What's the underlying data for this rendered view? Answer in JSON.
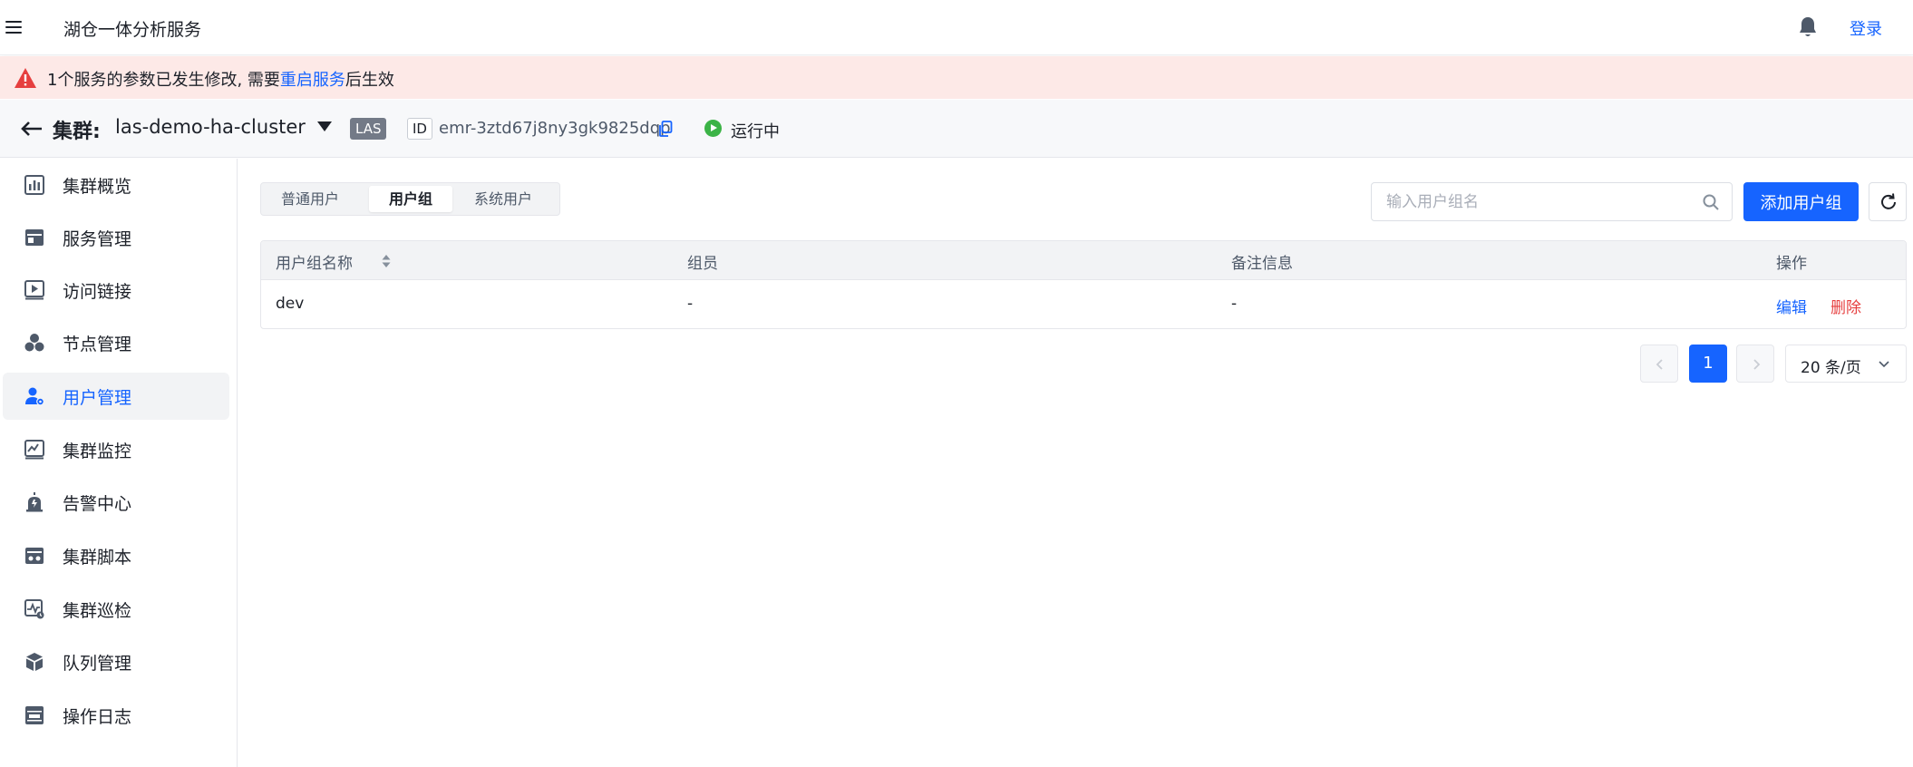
{
  "header": {
    "app_title": "湖仓一体分析服务",
    "login_label": "登录"
  },
  "alert": {
    "text_before": "1个服务的参数已发生修改, 需要",
    "link": "重启服务",
    "text_after": "后生效"
  },
  "cluster": {
    "label": "集群:",
    "name": "las-demo-ha-cluster",
    "badge": "LAS",
    "id_label": "ID",
    "id_value": "emr-3ztd67j8ny3gk9825dqp",
    "status": "运行中",
    "status_color": "#3bb346"
  },
  "sidebar": {
    "active_index": 4,
    "items": [
      {
        "label": "集群概览",
        "icon": "bar-chart-icon"
      },
      {
        "label": "服务管理",
        "icon": "service-icon"
      },
      {
        "label": "访问链接",
        "icon": "link-play-icon"
      },
      {
        "label": "节点管理",
        "icon": "nodes-icon"
      },
      {
        "label": "用户管理",
        "icon": "user-settings-icon"
      },
      {
        "label": "集群监控",
        "icon": "monitor-icon"
      },
      {
        "label": "告警中心",
        "icon": "alarm-icon"
      },
      {
        "label": "集群脚本",
        "icon": "script-icon"
      },
      {
        "label": "集群巡检",
        "icon": "inspect-icon"
      },
      {
        "label": "队列管理",
        "icon": "queue-cube-icon"
      },
      {
        "label": "操作日志",
        "icon": "log-icon"
      }
    ]
  },
  "tabs": [
    {
      "label": "普通用户"
    },
    {
      "label": "用户组",
      "active": true
    },
    {
      "label": "系统用户"
    }
  ],
  "search": {
    "placeholder": "输入用户组名"
  },
  "toolbar": {
    "add_label": "添加用户组"
  },
  "table": {
    "columns": [
      "用户组名称",
      "组员",
      "备注信息",
      "操作"
    ],
    "rows": [
      {
        "name": "dev",
        "members": "-",
        "remark": "-",
        "edit": "编辑",
        "delete": "删除"
      }
    ]
  },
  "pagination": {
    "current_page": "1",
    "page_size": "20 条/页"
  },
  "colors": {
    "primary": "#1664ff",
    "danger": "#e63f3f",
    "alert_bg": "#fde9e7"
  }
}
